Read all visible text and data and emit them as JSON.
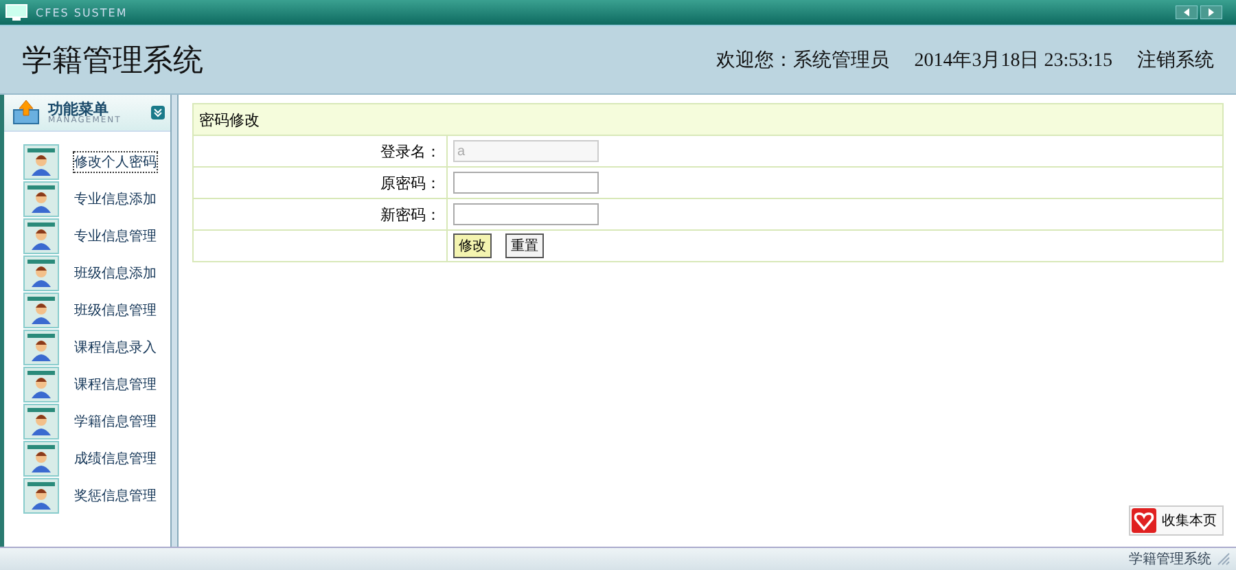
{
  "window": {
    "title": "CFES SUSTEM"
  },
  "header": {
    "app_title": "学籍管理系统",
    "welcome": "欢迎您：系统管理员",
    "datetime": "2014年3月18日  23:53:15",
    "logout": "注销系统"
  },
  "sidebar": {
    "title": "功能菜单",
    "subtitle": "MANAGEMENT",
    "items": [
      {
        "label": "修改个人密码",
        "selected": true
      },
      {
        "label": "专业信息添加",
        "selected": false
      },
      {
        "label": "专业信息管理",
        "selected": false
      },
      {
        "label": "班级信息添加",
        "selected": false
      },
      {
        "label": "班级信息管理",
        "selected": false
      },
      {
        "label": "课程信息录入",
        "selected": false
      },
      {
        "label": "课程信息管理",
        "selected": false
      },
      {
        "label": "学籍信息管理",
        "selected": false
      },
      {
        "label": "成绩信息管理",
        "selected": false
      },
      {
        "label": "奖惩信息管理",
        "selected": false
      }
    ]
  },
  "form": {
    "title": "密码修改",
    "fields": [
      {
        "label": "登录名：",
        "value": "a",
        "disabled": true
      },
      {
        "label": "原密码：",
        "disabled": false
      },
      {
        "label": "新密码：",
        "disabled": false
      }
    ],
    "buttons": [
      {
        "label": "修改",
        "highlighted": true
      },
      {
        "label": "重置",
        "highlighted": false
      }
    ]
  },
  "favorite_button": "收集本页",
  "status_bar": "学籍管理系统"
}
